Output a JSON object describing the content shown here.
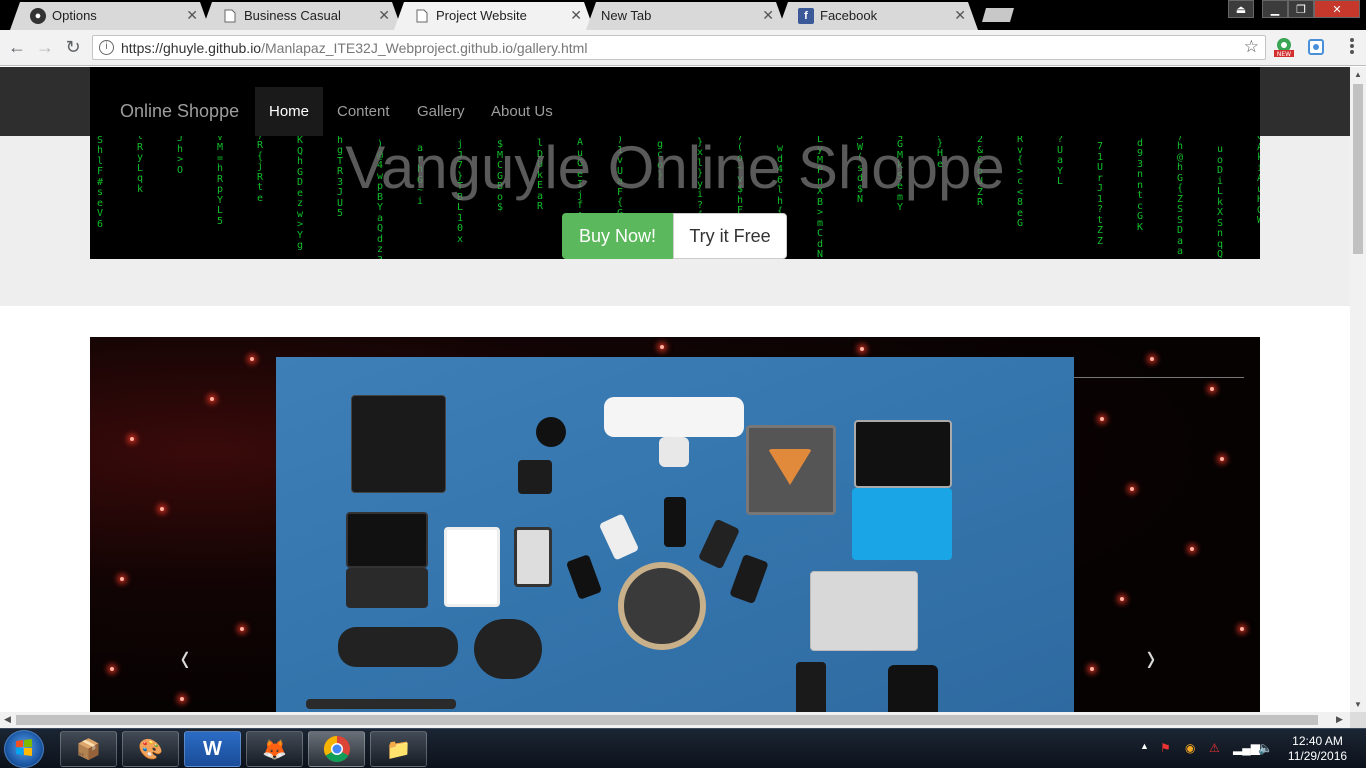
{
  "browser": {
    "tabs": [
      {
        "title": "Options",
        "favicon": "github-icon",
        "active": false
      },
      {
        "title": "Business Casual",
        "favicon": "page-icon",
        "active": false
      },
      {
        "title": "Project Website",
        "favicon": "page-icon",
        "active": true
      },
      {
        "title": "New Tab",
        "favicon": "none",
        "active": false
      },
      {
        "title": "Facebook",
        "favicon": "facebook-icon",
        "active": false
      }
    ],
    "close_glyph": "✕",
    "url_host": "https://ghuyle.github.io",
    "url_path": "/Manlapaz_ITE32J_Webproject.github.io/gallery.html"
  },
  "page": {
    "brand": "Online Shoppe",
    "nav": [
      {
        "label": "Home",
        "active": true
      },
      {
        "label": "Content",
        "active": false
      },
      {
        "label": "Gallery",
        "active": false
      },
      {
        "label": "About Us",
        "active": false
      }
    ],
    "hero_title": "Vanguyle Online Shoppe",
    "buy_label": "Buy Now!",
    "try_label": "Try it Free",
    "carousel_prev": "‹",
    "carousel_next": "›"
  },
  "taskbar": {
    "apps": [
      {
        "name": "winrar-icon",
        "glyph": "📦"
      },
      {
        "name": "paint-icon",
        "glyph": "🎨"
      },
      {
        "name": "word-icon",
        "glyph": "W"
      },
      {
        "name": "firefox-icon",
        "glyph": "🦊"
      },
      {
        "name": "chrome-icon",
        "glyph": "◉"
      },
      {
        "name": "explorer-icon",
        "glyph": "📁"
      }
    ],
    "time": "12:40 AM",
    "date": "11/29/2016"
  },
  "colors": {
    "buy": "#5cb85c",
    "matrix_green": "#0fbf2a",
    "navbar": "#000000"
  }
}
